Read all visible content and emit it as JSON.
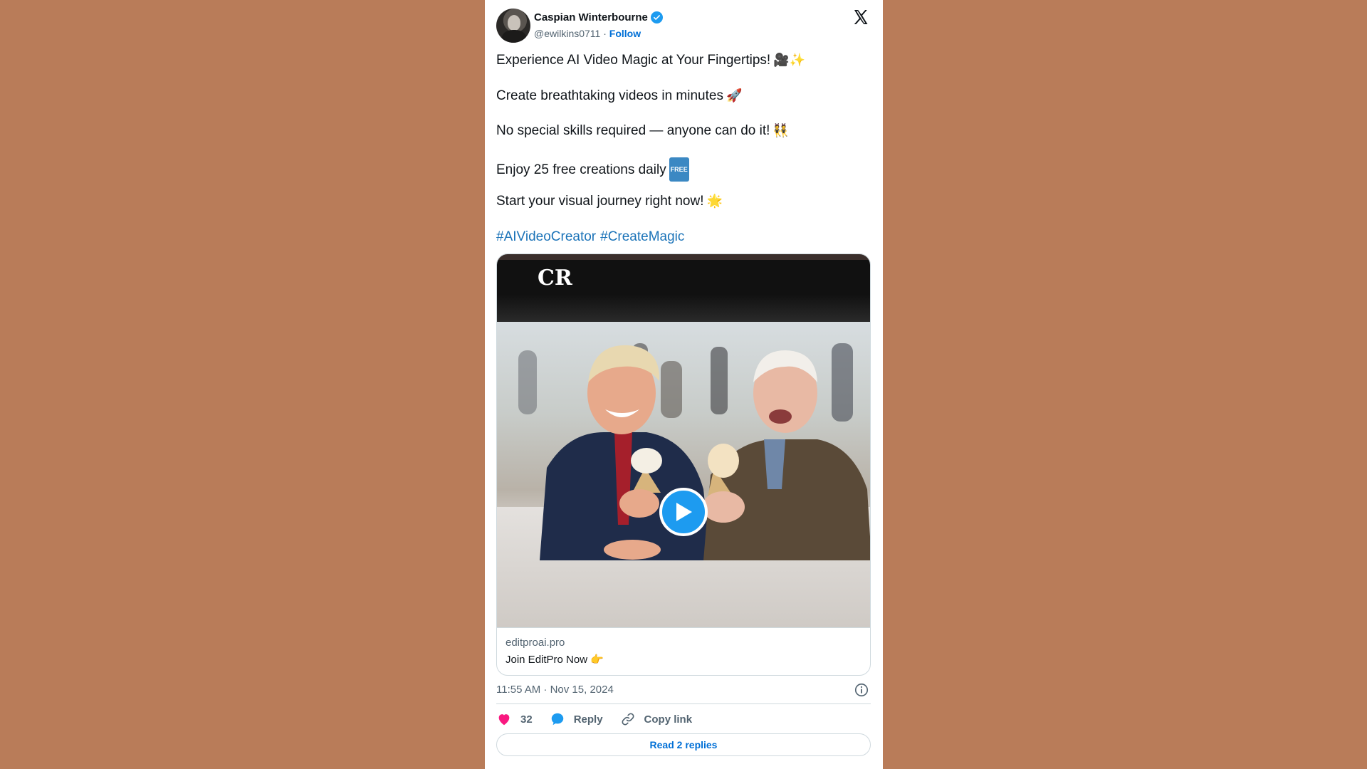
{
  "author": {
    "name": "Caspian Winterbourne",
    "handle": "@ewilkins0711",
    "separator": "·",
    "follow_label": "Follow"
  },
  "tweet": {
    "lines": [
      {
        "text": "Experience AI Video Magic at Your Fingertips!",
        "emoji": "🎥✨"
      },
      {
        "text": "Create breathtaking videos in minutes",
        "emoji": "🚀"
      },
      {
        "text": "No special skills required — anyone can do it!",
        "emoji": "👯"
      },
      {
        "text": "Enjoy 25 free creations daily",
        "badge": "FREE"
      },
      {
        "text": "Start your visual journey right now!",
        "emoji": "🌟"
      }
    ],
    "hashtags": [
      "#AIVideoCreator",
      "#CreateMagic"
    ]
  },
  "media": {
    "overlay_text": "CR",
    "link_domain": "editproai.pro",
    "link_title": "Join EditPro Now 👉"
  },
  "meta": {
    "timestamp": "11:55 AM · Nov 15, 2024"
  },
  "actions": {
    "like_count": "32",
    "reply_label": "Reply",
    "copy_link_label": "Copy link",
    "read_replies_label": "Read 2 replies"
  },
  "colors": {
    "page_background": "#b97c59",
    "accent_blue": "#1d9bf0",
    "link_blue": "#006fd6",
    "like_pink": "#f91880"
  }
}
